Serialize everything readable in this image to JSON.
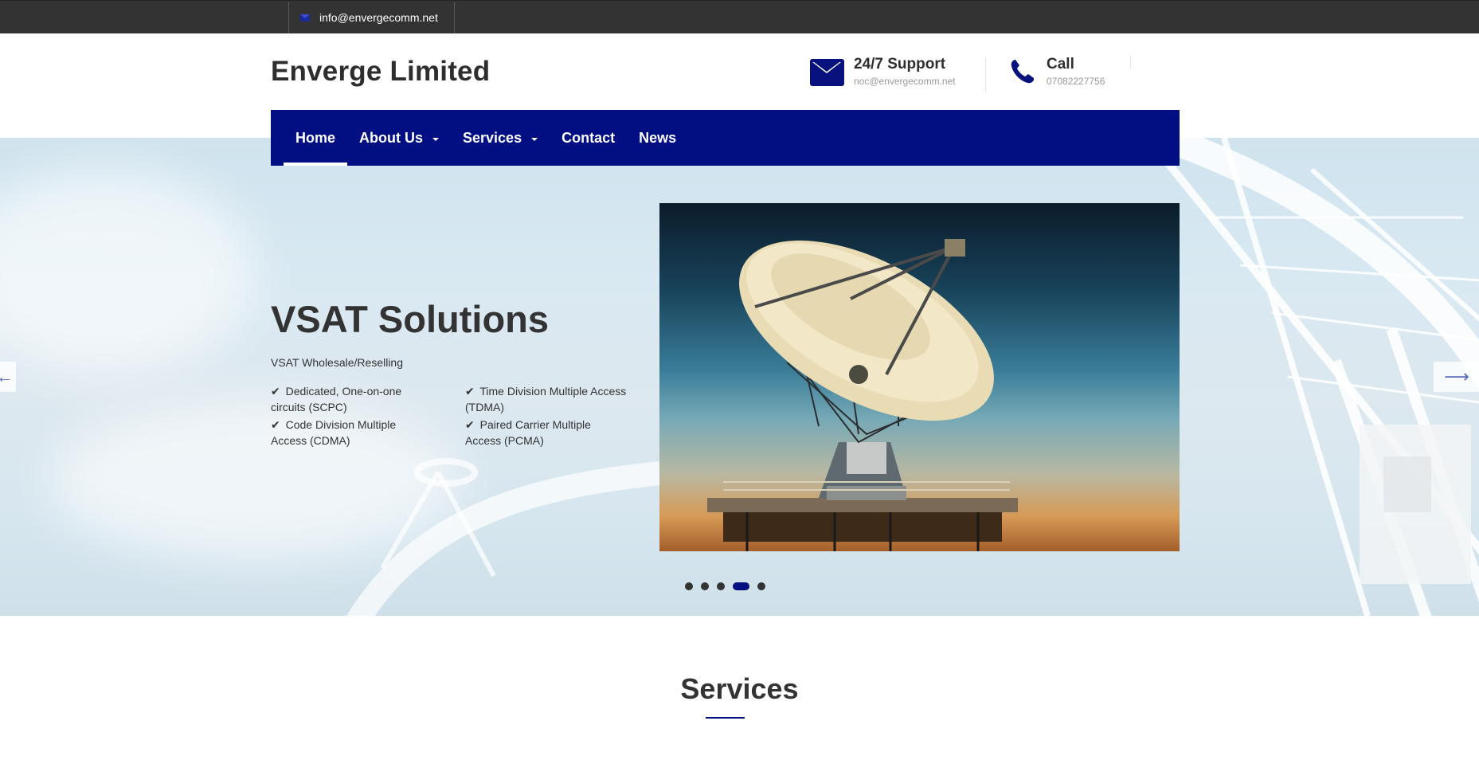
{
  "topbar": {
    "email": "info@envergecomm.net",
    "email_icon": "envelope-icon"
  },
  "header": {
    "logo": "Enverge Limited",
    "support": {
      "title": "24/7 Support",
      "subtitle": "noc@envergecomm.net",
      "icon": "envelope-icon"
    },
    "call": {
      "title": "Call",
      "subtitle": "07082227756",
      "icon": "phone-icon"
    }
  },
  "nav": {
    "items": [
      {
        "label": "Home",
        "active": true,
        "dropdown": false
      },
      {
        "label": "About Us",
        "active": false,
        "dropdown": true
      },
      {
        "label": "Services",
        "active": false,
        "dropdown": true
      },
      {
        "label": "Contact",
        "active": false,
        "dropdown": false
      },
      {
        "label": "News",
        "active": false,
        "dropdown": false
      }
    ]
  },
  "hero": {
    "title": "VSAT Solutions",
    "subtitle": "VSAT Wholesale/Reselling",
    "features": [
      "Dedicated, One-on-one circuits (SCPC)",
      "Time Division Multiple Access (TDMA)",
      "Code Division Multiple Access (CDMA)",
      "Paired Carrier Multiple Access (PCMA)"
    ],
    "check_symbol": "✔",
    "slides_total": 5,
    "active_slide": 4,
    "prev_arrow": "←",
    "next_arrow": "⟶"
  },
  "services": {
    "title": "Services"
  },
  "colors": {
    "brand": "#020f82",
    "topbar": "#333333",
    "text": "#333333"
  }
}
